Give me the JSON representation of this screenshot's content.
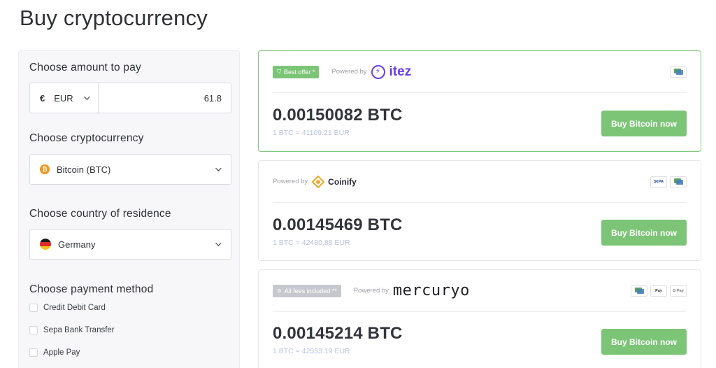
{
  "page_title": "Buy cryptocurrency",
  "left_panel": {
    "amount": {
      "heading": "Choose amount to pay",
      "currency_symbol": "€",
      "currency": "EUR",
      "value": "61.8"
    },
    "crypto": {
      "heading": "Choose cryptocurrency",
      "selected": "Bitcoin (BTC)",
      "icon": "bitcoin-icon",
      "icon_color": "#f7931a"
    },
    "country": {
      "heading": "Choose country of residence",
      "selected": "Germany",
      "icon": "germany-flag-icon"
    },
    "payment_method": {
      "heading": "Choose payment method",
      "options": [
        "Credit Debit Card",
        "Sepa Bank Transfer",
        "Apple Pay"
      ]
    }
  },
  "offers": [
    {
      "badge": "Best offer *",
      "powered_label": "Powered by",
      "provider": "itez",
      "btc_amount": "0.00150082 BTC",
      "rate": "1 BTC = 41169.21 EUR",
      "button": "Buy Bitcoin now",
      "payment_icons": [
        "card-icon"
      ]
    },
    {
      "badge": "",
      "powered_label": "Powered by",
      "provider": "Coinify",
      "btc_amount": "0.00145469 BTC",
      "rate": "1 BTC = 42480.88 EUR",
      "button": "Buy Bitcoin now",
      "payment_icons": [
        "sepa-icon",
        "card-icon"
      ],
      "sepa_label": "S€PA"
    },
    {
      "badge": "All fees included **",
      "powered_label": "Powered by",
      "provider": "mercuryo",
      "btc_amount": "0.00145214 BTC",
      "rate": "1 BTC = 42553.19 EUR",
      "button": "Buy Bitcoin now",
      "payment_icons": [
        "card-icon",
        "apple-pay-icon",
        "google-pay-icon"
      ],
      "apple_pay_label": "Pay",
      "google_pay_label": "G Pay"
    }
  ],
  "colors": {
    "accent_green": "#7cc576",
    "best_border": "#7fc97b",
    "itez_purple": "#6a3de8",
    "coinify_orange": "#f5a623",
    "rate_text": "#b8c3e2"
  }
}
